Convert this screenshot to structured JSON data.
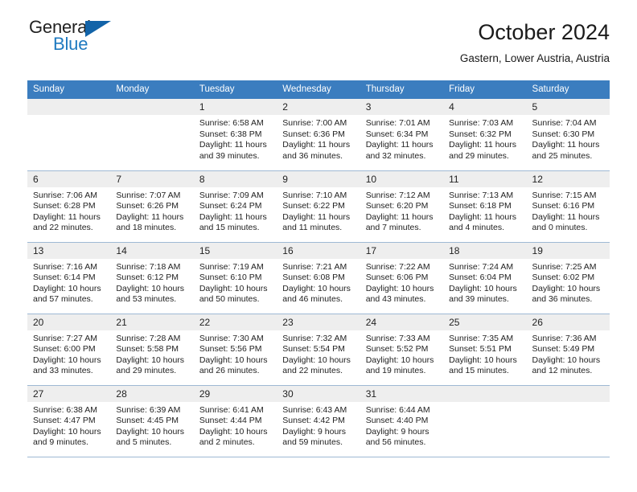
{
  "brand": {
    "name_part1": "General",
    "name_part2": "Blue",
    "accent_color": "#1f7ac0",
    "triangle_color": "#1263a8"
  },
  "header": {
    "title": "October 2024",
    "subtitle": "Gastern, Lower Austria, Austria"
  },
  "calendar": {
    "header_color": "#3b7dbf",
    "weekdays": [
      "Sunday",
      "Monday",
      "Tuesday",
      "Wednesday",
      "Thursday",
      "Friday",
      "Saturday"
    ],
    "weeks": [
      [
        {
          "day": "",
          "sunrise": "",
          "sunset": "",
          "daylight1": "",
          "daylight2": ""
        },
        {
          "day": "",
          "sunrise": "",
          "sunset": "",
          "daylight1": "",
          "daylight2": ""
        },
        {
          "day": "1",
          "sunrise": "Sunrise: 6:58 AM",
          "sunset": "Sunset: 6:38 PM",
          "daylight1": "Daylight: 11 hours",
          "daylight2": "and 39 minutes."
        },
        {
          "day": "2",
          "sunrise": "Sunrise: 7:00 AM",
          "sunset": "Sunset: 6:36 PM",
          "daylight1": "Daylight: 11 hours",
          "daylight2": "and 36 minutes."
        },
        {
          "day": "3",
          "sunrise": "Sunrise: 7:01 AM",
          "sunset": "Sunset: 6:34 PM",
          "daylight1": "Daylight: 11 hours",
          "daylight2": "and 32 minutes."
        },
        {
          "day": "4",
          "sunrise": "Sunrise: 7:03 AM",
          "sunset": "Sunset: 6:32 PM",
          "daylight1": "Daylight: 11 hours",
          "daylight2": "and 29 minutes."
        },
        {
          "day": "5",
          "sunrise": "Sunrise: 7:04 AM",
          "sunset": "Sunset: 6:30 PM",
          "daylight1": "Daylight: 11 hours",
          "daylight2": "and 25 minutes."
        }
      ],
      [
        {
          "day": "6",
          "sunrise": "Sunrise: 7:06 AM",
          "sunset": "Sunset: 6:28 PM",
          "daylight1": "Daylight: 11 hours",
          "daylight2": "and 22 minutes."
        },
        {
          "day": "7",
          "sunrise": "Sunrise: 7:07 AM",
          "sunset": "Sunset: 6:26 PM",
          "daylight1": "Daylight: 11 hours",
          "daylight2": "and 18 minutes."
        },
        {
          "day": "8",
          "sunrise": "Sunrise: 7:09 AM",
          "sunset": "Sunset: 6:24 PM",
          "daylight1": "Daylight: 11 hours",
          "daylight2": "and 15 minutes."
        },
        {
          "day": "9",
          "sunrise": "Sunrise: 7:10 AM",
          "sunset": "Sunset: 6:22 PM",
          "daylight1": "Daylight: 11 hours",
          "daylight2": "and 11 minutes."
        },
        {
          "day": "10",
          "sunrise": "Sunrise: 7:12 AM",
          "sunset": "Sunset: 6:20 PM",
          "daylight1": "Daylight: 11 hours",
          "daylight2": "and 7 minutes."
        },
        {
          "day": "11",
          "sunrise": "Sunrise: 7:13 AM",
          "sunset": "Sunset: 6:18 PM",
          "daylight1": "Daylight: 11 hours",
          "daylight2": "and 4 minutes."
        },
        {
          "day": "12",
          "sunrise": "Sunrise: 7:15 AM",
          "sunset": "Sunset: 6:16 PM",
          "daylight1": "Daylight: 11 hours",
          "daylight2": "and 0 minutes."
        }
      ],
      [
        {
          "day": "13",
          "sunrise": "Sunrise: 7:16 AM",
          "sunset": "Sunset: 6:14 PM",
          "daylight1": "Daylight: 10 hours",
          "daylight2": "and 57 minutes."
        },
        {
          "day": "14",
          "sunrise": "Sunrise: 7:18 AM",
          "sunset": "Sunset: 6:12 PM",
          "daylight1": "Daylight: 10 hours",
          "daylight2": "and 53 minutes."
        },
        {
          "day": "15",
          "sunrise": "Sunrise: 7:19 AM",
          "sunset": "Sunset: 6:10 PM",
          "daylight1": "Daylight: 10 hours",
          "daylight2": "and 50 minutes."
        },
        {
          "day": "16",
          "sunrise": "Sunrise: 7:21 AM",
          "sunset": "Sunset: 6:08 PM",
          "daylight1": "Daylight: 10 hours",
          "daylight2": "and 46 minutes."
        },
        {
          "day": "17",
          "sunrise": "Sunrise: 7:22 AM",
          "sunset": "Sunset: 6:06 PM",
          "daylight1": "Daylight: 10 hours",
          "daylight2": "and 43 minutes."
        },
        {
          "day": "18",
          "sunrise": "Sunrise: 7:24 AM",
          "sunset": "Sunset: 6:04 PM",
          "daylight1": "Daylight: 10 hours",
          "daylight2": "and 39 minutes."
        },
        {
          "day": "19",
          "sunrise": "Sunrise: 7:25 AM",
          "sunset": "Sunset: 6:02 PM",
          "daylight1": "Daylight: 10 hours",
          "daylight2": "and 36 minutes."
        }
      ],
      [
        {
          "day": "20",
          "sunrise": "Sunrise: 7:27 AM",
          "sunset": "Sunset: 6:00 PM",
          "daylight1": "Daylight: 10 hours",
          "daylight2": "and 33 minutes."
        },
        {
          "day": "21",
          "sunrise": "Sunrise: 7:28 AM",
          "sunset": "Sunset: 5:58 PM",
          "daylight1": "Daylight: 10 hours",
          "daylight2": "and 29 minutes."
        },
        {
          "day": "22",
          "sunrise": "Sunrise: 7:30 AM",
          "sunset": "Sunset: 5:56 PM",
          "daylight1": "Daylight: 10 hours",
          "daylight2": "and 26 minutes."
        },
        {
          "day": "23",
          "sunrise": "Sunrise: 7:32 AM",
          "sunset": "Sunset: 5:54 PM",
          "daylight1": "Daylight: 10 hours",
          "daylight2": "and 22 minutes."
        },
        {
          "day": "24",
          "sunrise": "Sunrise: 7:33 AM",
          "sunset": "Sunset: 5:52 PM",
          "daylight1": "Daylight: 10 hours",
          "daylight2": "and 19 minutes."
        },
        {
          "day": "25",
          "sunrise": "Sunrise: 7:35 AM",
          "sunset": "Sunset: 5:51 PM",
          "daylight1": "Daylight: 10 hours",
          "daylight2": "and 15 minutes."
        },
        {
          "day": "26",
          "sunrise": "Sunrise: 7:36 AM",
          "sunset": "Sunset: 5:49 PM",
          "daylight1": "Daylight: 10 hours",
          "daylight2": "and 12 minutes."
        }
      ],
      [
        {
          "day": "27",
          "sunrise": "Sunrise: 6:38 AM",
          "sunset": "Sunset: 4:47 PM",
          "daylight1": "Daylight: 10 hours",
          "daylight2": "and 9 minutes."
        },
        {
          "day": "28",
          "sunrise": "Sunrise: 6:39 AM",
          "sunset": "Sunset: 4:45 PM",
          "daylight1": "Daylight: 10 hours",
          "daylight2": "and 5 minutes."
        },
        {
          "day": "29",
          "sunrise": "Sunrise: 6:41 AM",
          "sunset": "Sunset: 4:44 PM",
          "daylight1": "Daylight: 10 hours",
          "daylight2": "and 2 minutes."
        },
        {
          "day": "30",
          "sunrise": "Sunrise: 6:43 AM",
          "sunset": "Sunset: 4:42 PM",
          "daylight1": "Daylight: 9 hours",
          "daylight2": "and 59 minutes."
        },
        {
          "day": "31",
          "sunrise": "Sunrise: 6:44 AM",
          "sunset": "Sunset: 4:40 PM",
          "daylight1": "Daylight: 9 hours",
          "daylight2": "and 56 minutes."
        },
        {
          "day": "",
          "sunrise": "",
          "sunset": "",
          "daylight1": "",
          "daylight2": ""
        },
        {
          "day": "",
          "sunrise": "",
          "sunset": "",
          "daylight1": "",
          "daylight2": ""
        }
      ]
    ]
  }
}
